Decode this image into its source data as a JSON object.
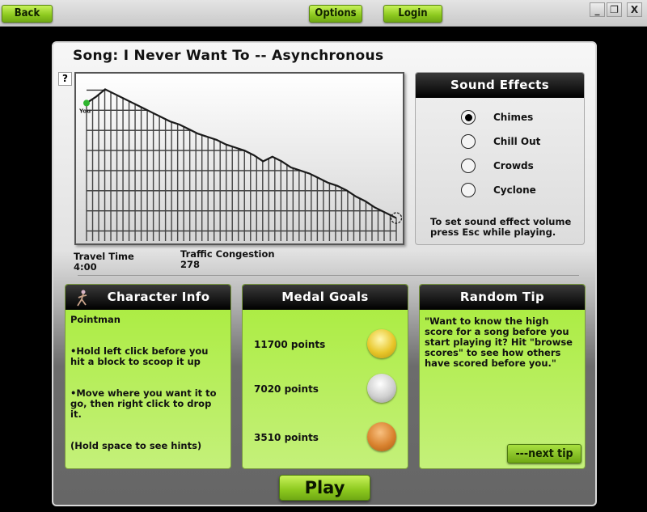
{
  "topbar": {
    "back_label": "Back",
    "options_label": "Options",
    "login_label": "Login",
    "window_controls": {
      "minimize": "_",
      "restore": "❐",
      "close": "X"
    }
  },
  "song": {
    "title": "Song: I Never Want To -- Asynchronous",
    "help_label": "?"
  },
  "chart_data": {
    "type": "line",
    "title": "",
    "xlabel": "",
    "ylabel": "",
    "marker_label": "You",
    "marker_color": "#2fb52f",
    "end_marker": "finish-circle",
    "grid": true,
    "x": [
      0,
      3,
      6,
      9,
      12,
      15,
      18,
      21,
      24,
      27,
      30,
      33,
      36,
      39,
      42,
      45,
      48,
      51,
      54,
      57,
      60,
      63,
      66,
      69,
      72,
      75,
      78,
      81,
      84,
      87,
      90,
      93,
      96,
      100
    ],
    "values": [
      90,
      94,
      99,
      96,
      93,
      90,
      87,
      84,
      81,
      78,
      76,
      73,
      70,
      68,
      66,
      63,
      61,
      59,
      56,
      52,
      55,
      52,
      48,
      46,
      44,
      41,
      38,
      36,
      33,
      29,
      26,
      22,
      19,
      15
    ],
    "xlim": [
      0,
      100
    ],
    "ylim": [
      0,
      105
    ]
  },
  "stats": {
    "travel_time_label": "Travel Time",
    "travel_time_value": "4:00",
    "traffic_label": "Traffic Congestion",
    "traffic_value": "278"
  },
  "sound_effects": {
    "title": "Sound Effects",
    "options": [
      {
        "label": "Chimes",
        "selected": true
      },
      {
        "label": "Chill Out",
        "selected": false
      },
      {
        "label": "Crowds",
        "selected": false
      },
      {
        "label": "Cyclone",
        "selected": false
      }
    ],
    "note_line1": "To set sound effect volume",
    "note_line2": "press Esc while playing."
  },
  "character": {
    "title": "Character Info",
    "name": "Pointman",
    "tip1": "•Hold left click before you hit a block to scoop it up",
    "tip2": "•Move where you want it to go, then right click to drop it.",
    "tip3": "(Hold space to see hints)"
  },
  "medals": {
    "title": "Medal Goals",
    "goals": [
      {
        "label": "11700 points",
        "medal": "gold",
        "color": "#e8c62a"
      },
      {
        "label": "7020 points",
        "medal": "silver",
        "color": "#c9c9c9"
      },
      {
        "label": "3510 points",
        "medal": "bronze",
        "color": "#d9822e"
      }
    ]
  },
  "random_tip": {
    "title": "Random Tip",
    "text": "\"Want to know the high score for a song before you start playing it? Hit \"browse scores\" to see how others have scored before you.\"",
    "next_label": "---next tip"
  },
  "play_label": "Play"
}
